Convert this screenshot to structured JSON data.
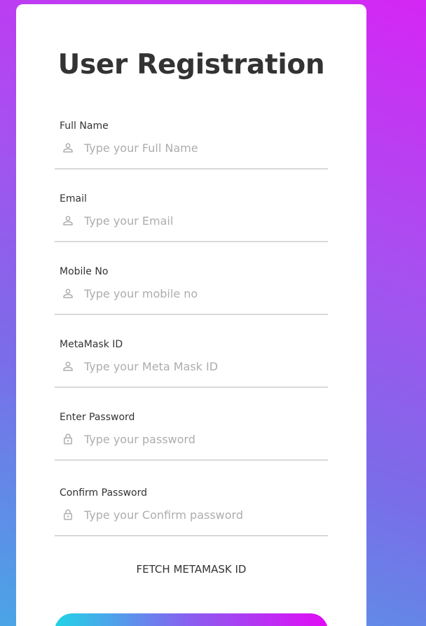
{
  "form": {
    "title": "User Registration",
    "fields": [
      {
        "label": "Full Name",
        "placeholder": "Type your Full Name",
        "icon": "user-icon"
      },
      {
        "label": "Email",
        "placeholder": "Type your Email",
        "icon": "user-icon"
      },
      {
        "label": "Mobile No",
        "placeholder": "Type your mobile no",
        "icon": "user-icon"
      },
      {
        "label": "MetaMask ID",
        "placeholder": "Type your Meta Mask ID",
        "icon": "user-icon"
      },
      {
        "label": "Enter Password",
        "placeholder": "Type your password",
        "icon": "lock-icon"
      },
      {
        "label": "Confirm Password",
        "placeholder": "Type your Confirm password",
        "icon": "lock-icon"
      }
    ],
    "fetch_label": "FETCH METAMASK ID"
  },
  "colors": {
    "background_start": "#d526f4",
    "background_end": "#4aa5e6",
    "card": "#ffffff",
    "title_text": "#333333",
    "placeholder": "#adadad",
    "underline": "#d9d9d9",
    "button_gradient_start": "#21d4e6",
    "button_gradient_end": "#e20af5"
  }
}
